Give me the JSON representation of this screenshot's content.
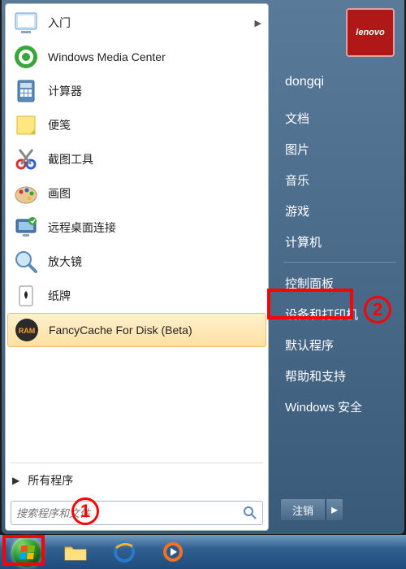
{
  "programs": [
    {
      "label": "入门",
      "icon": "getting-started",
      "expand": true
    },
    {
      "label": "Windows Media Center",
      "icon": "media-center",
      "expand": false
    },
    {
      "label": "计算器",
      "icon": "calculator",
      "expand": false
    },
    {
      "label": "便笺",
      "icon": "sticky-notes",
      "expand": false
    },
    {
      "label": "截图工具",
      "icon": "snipping-tool",
      "expand": false
    },
    {
      "label": "画图",
      "icon": "paint",
      "expand": false
    },
    {
      "label": "远程桌面连接",
      "icon": "remote-desktop",
      "expand": false
    },
    {
      "label": "放大镜",
      "icon": "magnifier",
      "expand": false
    },
    {
      "label": "纸牌",
      "icon": "solitaire",
      "expand": false
    },
    {
      "label": "FancyCache For Disk (Beta)",
      "icon": "fancycache",
      "expand": false,
      "selected": true
    }
  ],
  "all_programs_label": "所有程序",
  "search": {
    "placeholder": "搜索程序和文件"
  },
  "user": {
    "name": "dongqi",
    "avatar_text": "lenovo"
  },
  "right_items": [
    "文档",
    "图片",
    "音乐",
    "游戏",
    "计算机"
  ],
  "right_items2": [
    "控制面板",
    "设备和打印机",
    "默认程序",
    "帮助和支持",
    "Windows 安全"
  ],
  "shutdown_label": "注销",
  "annotations": {
    "one": "1",
    "two": "2"
  },
  "colors": {
    "highlight": "#ff0000",
    "selected_bg": "#ffe0a0"
  }
}
